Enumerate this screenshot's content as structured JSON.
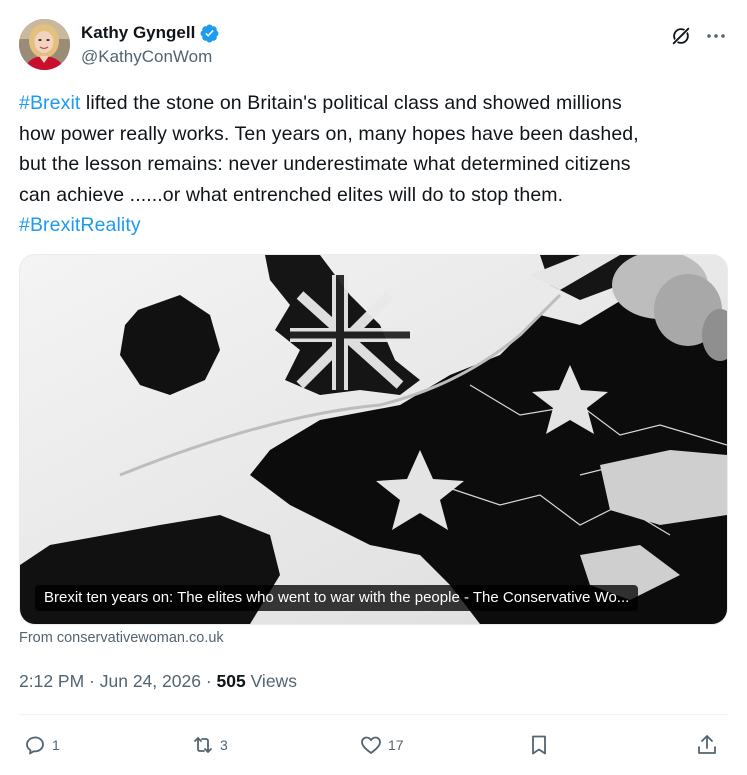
{
  "author": {
    "display_name": "Kathy Gyngell",
    "handle": "@KathyConWom",
    "verified": true
  },
  "tweet": {
    "lines": [
      {
        "hashtag": "#Brexit",
        "text": " lifted the stone on Britain's political class and showed millions"
      },
      {
        "text": "how power really works.  Ten years on, many hopes have been dashed,"
      },
      {
        "text": "but the lesson remains: never underestimate what determined citizens"
      },
      {
        "text": "can achieve ......or what entrenched elites will do to stop them."
      },
      {
        "hashtag": "#BrexitReality"
      }
    ]
  },
  "card": {
    "caption": "Brexit ten years on: The elites who went to war with the people - The Conservative Wo...",
    "source": "From conservativewoman.co.uk"
  },
  "meta": {
    "time": "2:12 PM",
    "separator": " · ",
    "date": "Jun 24, 2026",
    "views_count": "505",
    "views_label": " Views"
  },
  "actions": {
    "reply_count": "1",
    "retweet_count": "3",
    "like_count": "17"
  },
  "icons": {
    "verified": "verified-badge-icon",
    "grok": "grok-icon",
    "more": "more-icon",
    "reply": "reply-icon",
    "retweet": "retweet-icon",
    "like": "heart-icon",
    "bookmark": "bookmark-icon",
    "share": "share-icon"
  },
  "colors": {
    "accent": "#1d9bf0",
    "text": "#0f1419",
    "secondary": "#536471"
  }
}
